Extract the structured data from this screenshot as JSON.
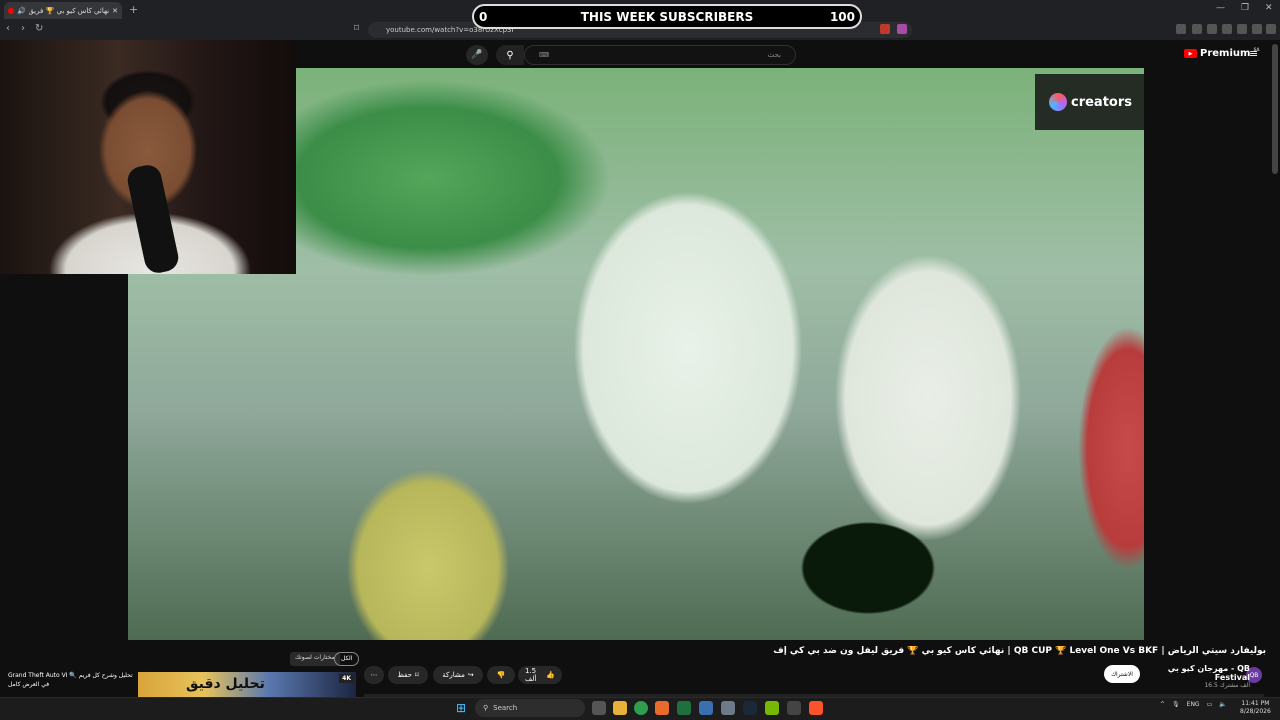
{
  "browser": {
    "tab_title": "نهائي كأس كيو بي 🏆 فريق ل",
    "new_tab": "+",
    "url": "youtube.com/watch?v=o38rUzXcp3I",
    "window_controls": [
      "—",
      "❐",
      "✕"
    ]
  },
  "overlay": {
    "left_value": "0",
    "title": "THIS WEEK SUBSCRIBERS",
    "right_value": "100"
  },
  "youtube": {
    "search_placeholder": "بحث",
    "logo_text": "Premium",
    "logo_superscript": "SA",
    "creators_watermark": "creators"
  },
  "video": {
    "title": "نهائي كأس كيو بي 🏆 فريق ليفل ون ضد بي كي إف | QB CUP 🏆 Level One Vs BKF | بوليفارد سيتي الرياض",
    "channel_name": "مهرجان كيو بي - QB Festival",
    "channel_subs": "16.5 ألف مشترك",
    "subscribe_label": "الاشتراك",
    "like_count": "1.5 ألف",
    "share_label": "مشاركة",
    "save_label": "حفظ",
    "more_label": "⋯"
  },
  "chips": {
    "all": "الكل",
    "tooltip": "مختارات لصوتك"
  },
  "recommendation": {
    "text": "Grand Theft Auto VI 🔍 تحليل وشرح كل فريم في العرض كامل",
    "thumb_badge": "4K",
    "thumb_text": "تحليل دقيق"
  },
  "taskbar": {
    "search": "Search",
    "language": "ENG",
    "time": "11:41 PM",
    "date": "8/28/2026"
  },
  "colors": {
    "yt_red": "#ff0000",
    "background": "#0f0f0f",
    "taskbar": "#1c1c1c"
  }
}
